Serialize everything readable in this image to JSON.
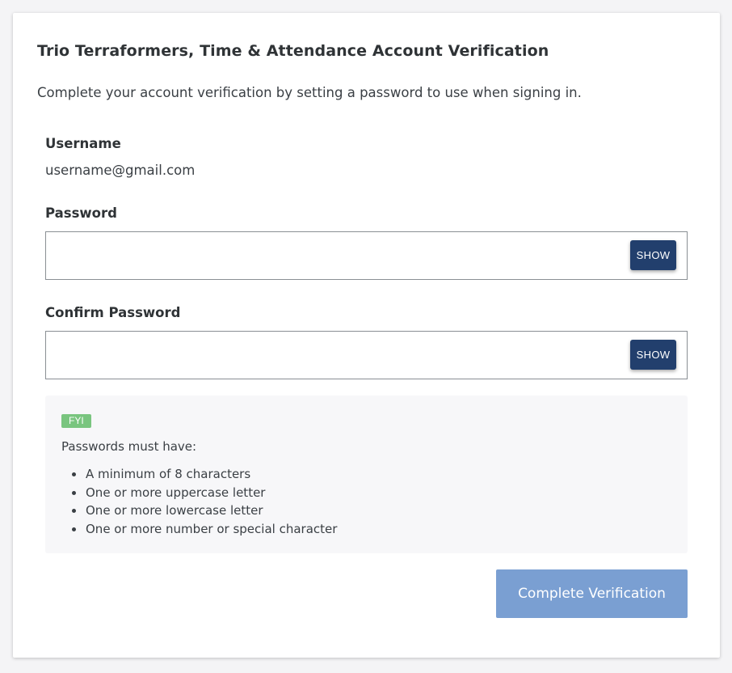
{
  "card": {
    "title": "Trio Terraformers, Time & Attendance Account Verification",
    "subtitle": "Complete your account verification by setting a password to use when signing in."
  },
  "username": {
    "label": "Username",
    "value": "username@gmail.com"
  },
  "password": {
    "label": "Password",
    "value": "",
    "show_label": "SHOW"
  },
  "confirm_password": {
    "label": "Confirm Password",
    "value": "",
    "show_label": "SHOW"
  },
  "fyi": {
    "badge": "FYI",
    "intro": "Passwords must have:",
    "requirements": [
      "A minimum of 8 characters",
      "One or more uppercase letter",
      "One or more lowercase letter",
      "One or more number or special character"
    ]
  },
  "submit": {
    "label": "Complete Verification"
  },
  "colors": {
    "show_button": "#223f6d",
    "submit_button_disabled": "#7a9fd2",
    "fyi_badge": "#79c57f",
    "panel_background": "#f7f7f9"
  }
}
